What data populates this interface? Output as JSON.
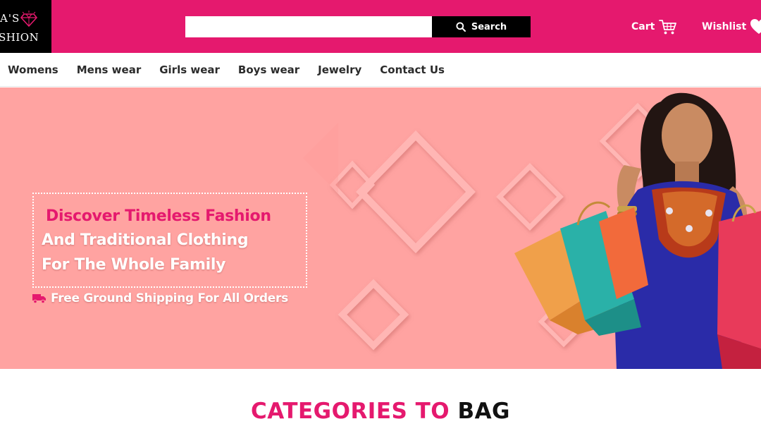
{
  "header": {
    "logo": {
      "line1": "A'S",
      "line2": "SHION"
    },
    "search": {
      "placeholder": "",
      "value": "",
      "button_label": "Search"
    },
    "cart_label": "Cart",
    "wishlist_label": "Wishlist"
  },
  "nav": {
    "items": [
      {
        "label": "Womens"
      },
      {
        "label": "Mens wear"
      },
      {
        "label": "Girls wear"
      },
      {
        "label": "Boys wear"
      },
      {
        "label": "Jewelry"
      },
      {
        "label": "Contact Us"
      }
    ]
  },
  "hero": {
    "title": "Discover Timeless Fashion",
    "line2": "And Traditional Clothing",
    "line3": "For The Whole Family",
    "shipping": "Free Ground Shipping For All Orders"
  },
  "categories": {
    "heading_part1": "CATEGORIES TO",
    "heading_part2": "BAG"
  },
  "colors": {
    "brand_pink": "#e5196e",
    "hero_background": "#ffa3a1",
    "search_button": "#000000",
    "logo_background": "#000000"
  },
  "icons": {
    "search": "search-icon",
    "cart": "cart-icon",
    "wishlist": "heart-icon",
    "shipping": "truck-icon",
    "logo": "diamond-icon"
  }
}
